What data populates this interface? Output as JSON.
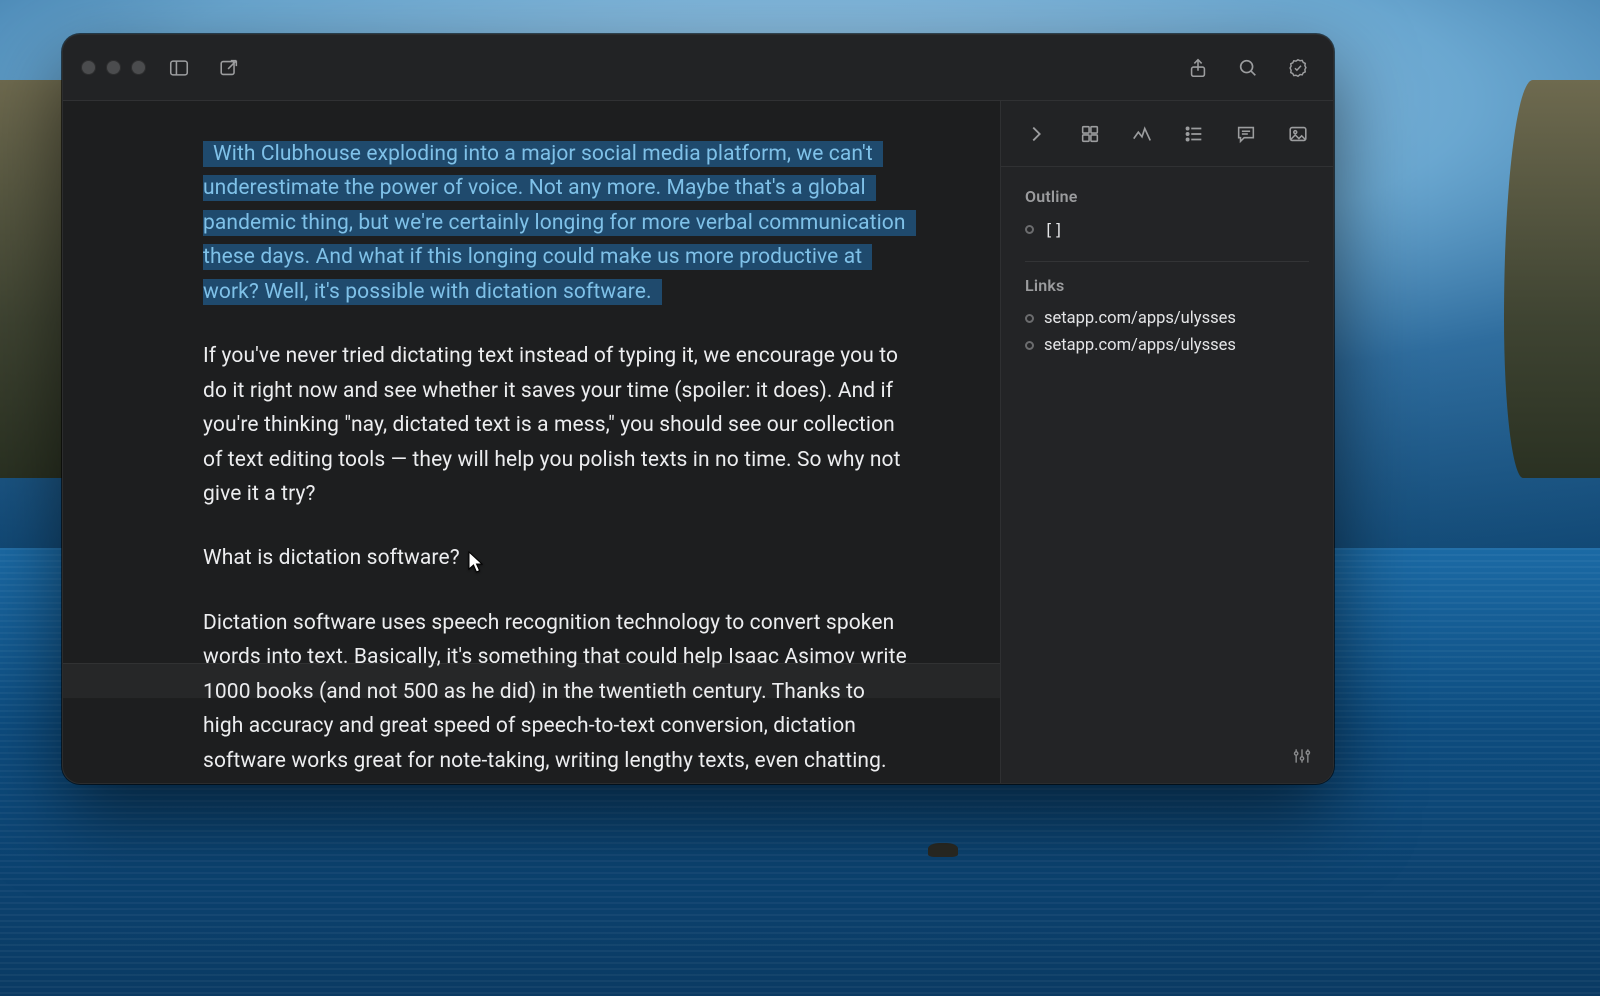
{
  "editor": {
    "paragraphs": {
      "p1_highlight": "With Clubhouse exploding into a major social media platform, we can't underestimate the power of voice. Not any more. Maybe that's a global pandemic thing, but we're certainly longing for more verbal communication these days. And what if this longing could make us more productive at work? Well, it's possible with dictation software.",
      "p2": "If you've never tried dictating text instead of typing it, we encourage you to do it right now and see whether it saves your time (spoiler: it does). And if you're thinking \"nay, dictated text is a mess,\" you should see our collection of text editing tools — they will help you polish texts in no time. So why not give it a try?",
      "h3": "What is dictation software?",
      "p3": "Dictation software uses speech recognition technology to convert spoken words into text. Basically, it's something that could help Isaac Asimov write 1000 books (and not 500 as he did) in the twentieth century. Thanks to high accuracy and great speed of speech-to-text conversion, dictation software works great for note-taking, writing lengthy texts, even chatting."
    }
  },
  "inspector": {
    "outline_title": "Outline",
    "outline_items": [
      {
        "label": "[]"
      }
    ],
    "links_title": "Links",
    "links": [
      {
        "label": "setapp.com/apps/ulysses"
      },
      {
        "label": "setapp.com/apps/ulysses"
      }
    ]
  }
}
